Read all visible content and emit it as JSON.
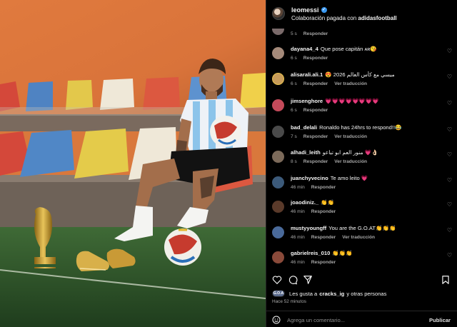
{
  "post": {
    "username": "leomessi",
    "collab_prefix": "Colaboración pagada con",
    "collab_brand": "adidasfootball"
  },
  "comments": [
    {
      "user": "",
      "text": "",
      "time": "5 s",
      "reply": "Responder",
      "translate": "",
      "avatar_color": "#7a6a6a"
    },
    {
      "user": "dayana4_4",
      "text": "Que pose capitán ᴀʀ😘",
      "time": "6 s",
      "reply": "Responder",
      "translate": "",
      "avatar_color": "#a58a7a"
    },
    {
      "user": "alisarali.ali.1",
      "text": "ميسي مع كأس العالم 2026 😍",
      "time": "6 s",
      "reply": "Responder",
      "translate": "Ver traducción",
      "avatar_color": "#c79b5a"
    },
    {
      "user": "jimsenghore",
      "text": "💗💗💗💗💗💗💗💗",
      "time": "6 s",
      "reply": "Responder",
      "translate": "",
      "avatar_color": "#c44a5a"
    },
    {
      "user": "bad_delali",
      "text": "Ronaldo has 24hrs to respond!!😂",
      "time": "7 s",
      "reply": "Responder",
      "translate": "Ver traducción",
      "avatar_color": "#4a4a4a"
    },
    {
      "user": "alhadi_leith",
      "text": "👌🏻💗 منور العم ابو تباعو",
      "time": "8 s",
      "reply": "Responder",
      "translate": "Ver traducción",
      "avatar_color": "#7c6a5a"
    },
    {
      "user": "juanchyvecino",
      "text": "Te amo leito 💗",
      "time": "46 min",
      "reply": "Responder",
      "translate": "",
      "avatar_color": "#3c5a7a"
    },
    {
      "user": "joaodiniz._",
      "text": "👏👏",
      "time": "46 min",
      "reply": "Responder",
      "translate": "",
      "avatar_color": "#5a3a2a"
    },
    {
      "user": "mustyyoungff",
      "text": "You are the G.O.AT👏👏👏",
      "time": "46 min",
      "reply": "Responder",
      "translate": "Ver traducción",
      "avatar_color": "#4a6a9a"
    },
    {
      "user": "gabrielreis_010",
      "text": "👏👏👏",
      "time": "46 min",
      "reply": "Responder",
      "translate": "",
      "avatar_color": "#8a4a3a"
    }
  ],
  "likes": {
    "prefix": "Les gusta a",
    "user": "cracks_ig",
    "suffix": "y otras personas",
    "avatar_text": "G.O.A"
  },
  "time_ago": "Hace 52 minutos",
  "add_comment": {
    "placeholder": "Agrega un comentario...",
    "publish": "Publicar"
  },
  "icons": [
    "heart-icon",
    "comment-icon",
    "share-icon",
    "bookmark-icon",
    "emoji-icon",
    "verified-icon"
  ]
}
